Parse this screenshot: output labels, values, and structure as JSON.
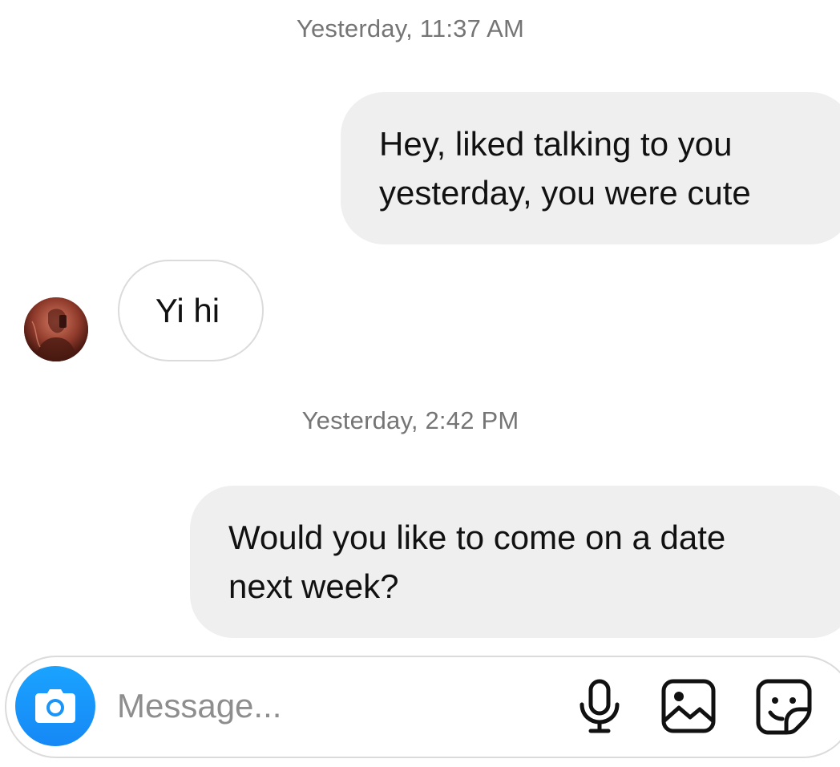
{
  "conversation": {
    "groups": [
      {
        "timestamp": "Yesterday, 11:37 AM",
        "messages": [
          {
            "direction": "outgoing",
            "text": "Hey, liked talking to you\nyesterday, you were cute"
          },
          {
            "direction": "incoming",
            "text": "Yi hi"
          }
        ]
      },
      {
        "timestamp": "Yesterday, 2:42 PM",
        "messages": [
          {
            "direction": "outgoing",
            "text": "Would you like to come on a date\nnext week?"
          }
        ]
      }
    ]
  },
  "composer": {
    "placeholder": "Message...",
    "value": "",
    "icons": {
      "camera": "camera-icon",
      "microphone": "microphone-icon",
      "photo": "photo-icon",
      "sticker": "sticker-icon"
    }
  },
  "colors": {
    "outgoing_bubble": "#efefef",
    "incoming_border": "#dbdbdb",
    "timestamp": "#757575",
    "camera_button": "#1a95f7",
    "placeholder": "#8e8e8e"
  }
}
